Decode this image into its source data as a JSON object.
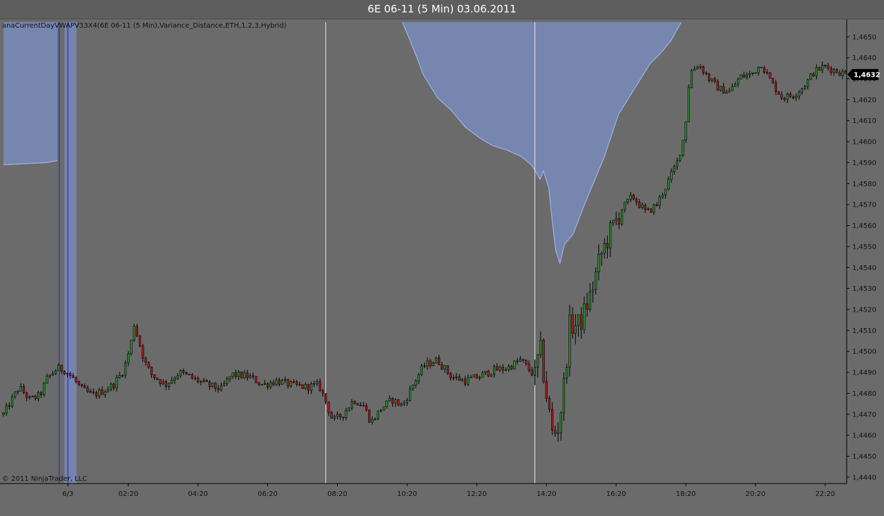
{
  "window": {
    "title": "6E 06-11 (5 Min)  03.06.2011"
  },
  "indicator": {
    "label": "anaCurrentDayVWAPV33X4(6E 06-11 (5 Min),Variance_Distance,ETH,1,2,3,Hybrid)"
  },
  "footer": {
    "copyright": "© 2011 NinjaTrader, LLC"
  },
  "colors": {
    "background": "#6b6b6b",
    "bull_candle": "#2e8b2e",
    "bear_candle": "#b01818",
    "wick": "#000000",
    "band_fill": "#7a8fc4",
    "band_line": "#9fb3ec",
    "session_line": "#e8e8e8",
    "marker_line": "#2a2ad0",
    "price_tag": "#000000"
  },
  "chart_data": {
    "type": "candlestick",
    "instrument": "6E 06-11",
    "interval": "5 Min",
    "y_ticks": [
      "1,4440",
      "1,4450",
      "1,4460",
      "1,4470",
      "1,4480",
      "1,4490",
      "1,4500",
      "1,4510",
      "1,4520",
      "1,4530",
      "1,4540",
      "1,4550",
      "1,4560",
      "1,4570",
      "1,4580",
      "1,4590",
      "1,4600",
      "1,4610",
      "1,4620",
      "1,4630",
      "1,4640",
      "1,4650"
    ],
    "ylim": [
      1.4437,
      1.4657
    ],
    "x_ticks": [
      {
        "label": "6/3",
        "hour": 0.6
      },
      {
        "label": "02:20",
        "hour": 2.333
      },
      {
        "label": "04:20",
        "hour": 4.333
      },
      {
        "label": "06:20",
        "hour": 6.333
      },
      {
        "label": "08:20",
        "hour": 8.333
      },
      {
        "label": "10:20",
        "hour": 10.333
      },
      {
        "label": "12:20",
        "hour": 12.333
      },
      {
        "label": "14:20",
        "hour": 14.333
      },
      {
        "label": "16:20",
        "hour": 16.333
      },
      {
        "label": "18:20",
        "hour": 18.333
      },
      {
        "label": "20:20",
        "hour": 20.333
      },
      {
        "label": "22:20",
        "hour": 22.333
      }
    ],
    "xlim_hours": [
      -1.25,
      22.95
    ],
    "last_price": {
      "value": 1.4632,
      "label": "1,4632"
    },
    "session_lines_hours": [
      8.0,
      14.0
    ],
    "marker_lines_hours": [
      0.35,
      0.6
    ],
    "marker_band_hours": [
      0.5,
      0.85
    ],
    "price_path": [
      [
        -1.25,
        1.447
      ],
      [
        -0.8,
        1.4483
      ],
      [
        -0.5,
        1.4477
      ],
      [
        -0.2,
        1.4479
      ],
      [
        0.0,
        1.4487
      ],
      [
        0.3,
        1.4492
      ],
      [
        0.5,
        1.4491
      ],
      [
        0.7,
        1.4488
      ],
      [
        1.0,
        1.4482
      ],
      [
        1.3,
        1.4479
      ],
      [
        1.6,
        1.4481
      ],
      [
        1.9,
        1.4484
      ],
      [
        2.2,
        1.4491
      ],
      [
        2.4,
        1.4503
      ],
      [
        2.5,
        1.4513
      ],
      [
        2.6,
        1.4507
      ],
      [
        2.8,
        1.4495
      ],
      [
        3.0,
        1.4489
      ],
      [
        3.4,
        1.4484
      ],
      [
        3.8,
        1.449
      ],
      [
        4.2,
        1.4487
      ],
      [
        4.6,
        1.4484
      ],
      [
        5.0,
        1.4482
      ],
      [
        5.3,
        1.4489
      ],
      [
        5.8,
        1.4488
      ],
      [
        6.2,
        1.4484
      ],
      [
        6.6,
        1.4486
      ],
      [
        7.0,
        1.4484
      ],
      [
        7.4,
        1.4483
      ],
      [
        7.8,
        1.4484
      ],
      [
        8.0,
        1.4476
      ],
      [
        8.2,
        1.4467
      ],
      [
        8.5,
        1.447
      ],
      [
        8.8,
        1.4477
      ],
      [
        9.1,
        1.4474
      ],
      [
        9.3,
        1.4466
      ],
      [
        9.6,
        1.4473
      ],
      [
        9.9,
        1.4477
      ],
      [
        10.2,
        1.4474
      ],
      [
        10.5,
        1.4484
      ],
      [
        10.8,
        1.4493
      ],
      [
        11.2,
        1.4496
      ],
      [
        11.6,
        1.4488
      ],
      [
        12.0,
        1.4486
      ],
      [
        12.4,
        1.4488
      ],
      [
        12.8,
        1.4491
      ],
      [
        13.2,
        1.4492
      ],
      [
        13.6,
        1.4496
      ],
      [
        14.0,
        1.4488
      ],
      [
        14.15,
        1.4502
      ],
      [
        14.3,
        1.4483
      ],
      [
        14.5,
        1.4461
      ],
      [
        14.65,
        1.4462
      ],
      [
        14.8,
        1.4478
      ],
      [
        15.0,
        1.4512
      ],
      [
        15.3,
        1.4513
      ],
      [
        15.6,
        1.4527
      ],
      [
        15.9,
        1.4546
      ],
      [
        16.2,
        1.4558
      ],
      [
        16.5,
        1.4568
      ],
      [
        16.8,
        1.4574
      ],
      [
        17.2,
        1.4566
      ],
      [
        17.5,
        1.457
      ],
      [
        17.8,
        1.458
      ],
      [
        18.1,
        1.4591
      ],
      [
        18.3,
        1.4604
      ],
      [
        18.45,
        1.4633
      ],
      [
        18.7,
        1.4637
      ],
      [
        19.0,
        1.463
      ],
      [
        19.3,
        1.4625
      ],
      [
        19.6,
        1.4624
      ],
      [
        19.9,
        1.4631
      ],
      [
        20.2,
        1.4632
      ],
      [
        20.5,
        1.4637
      ],
      [
        20.8,
        1.4628
      ],
      [
        21.1,
        1.4621
      ],
      [
        21.4,
        1.4622
      ],
      [
        21.7,
        1.4626
      ],
      [
        22.0,
        1.4633
      ],
      [
        22.3,
        1.4636
      ],
      [
        22.6,
        1.4634
      ],
      [
        22.95,
        1.4632
      ]
    ],
    "band_segments": [
      {
        "name": "",
        "top": 1.4657,
        "lower": [
          [
            -1.25,
            1.4589
          ],
          [
            0.0,
            1.459
          ],
          [
            0.3,
            1.4591
          ]
        ]
      },
      {
        "name": "",
        "top": 1.4657,
        "lower": [
          [
            10.2,
            1.4657
          ],
          [
            10.5,
            1.4645
          ],
          [
            10.8,
            1.4632
          ],
          [
            11.2,
            1.4621
          ],
          [
            11.6,
            1.4615
          ],
          [
            12.0,
            1.4607
          ],
          [
            12.4,
            1.4602
          ],
          [
            12.8,
            1.4598
          ],
          [
            13.2,
            1.4596
          ],
          [
            13.6,
            1.4593
          ],
          [
            13.9,
            1.4589
          ],
          [
            14.05,
            1.4585
          ],
          [
            14.15,
            1.4582
          ],
          [
            14.25,
            1.4586
          ],
          [
            14.4,
            1.4578
          ],
          [
            14.5,
            1.4562
          ],
          [
            14.6,
            1.4548
          ],
          [
            14.72,
            1.4542
          ],
          [
            14.85,
            1.4551
          ],
          [
            15.1,
            1.4556
          ],
          [
            15.4,
            1.4569
          ],
          [
            15.7,
            1.4581
          ],
          [
            16.0,
            1.4593
          ],
          [
            16.2,
            1.4603
          ],
          [
            16.4,
            1.4613
          ],
          [
            16.7,
            1.4621
          ],
          [
            17.0,
            1.4629
          ],
          [
            17.3,
            1.4637
          ],
          [
            17.6,
            1.4642
          ],
          [
            17.9,
            1.4648
          ],
          [
            18.2,
            1.4657
          ]
        ]
      }
    ]
  }
}
